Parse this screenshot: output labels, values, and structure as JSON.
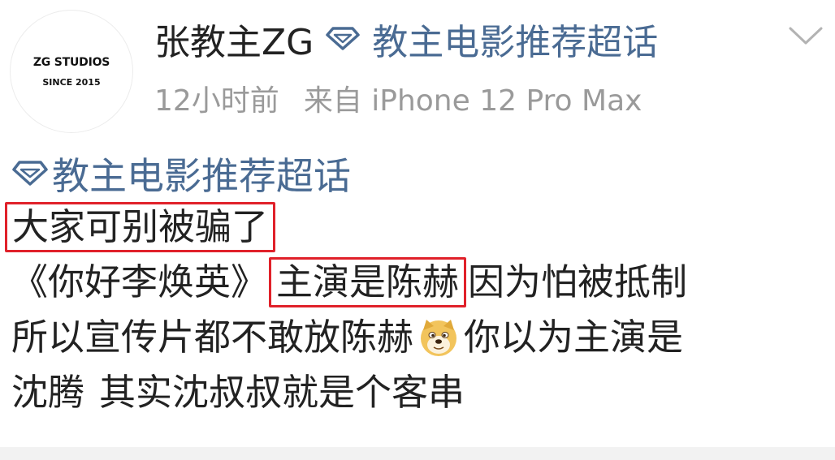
{
  "post": {
    "avatar": {
      "brand": "ZG STUDIOS",
      "since": "SINCE 2015"
    },
    "username": "张教主ZG",
    "topic_header": "教主电影推荐超话",
    "time_ago": "12小时前",
    "source": "来自 iPhone 12 Pro Max",
    "topic_tag": "教主电影推荐超话",
    "lines": {
      "l1_hl": "大家可别被骗了",
      "l2_a": "《你好李焕英》",
      "l2_hl": "主演是陈赫",
      "l2_b": "因为怕被抵制",
      "l3_a": "所以宣传片都不敢放陈赫",
      "l3_b": "你以为主演是",
      "l4_a": "沈腾",
      "l4_b": "其实沈叔叔就是个客串"
    }
  },
  "colors": {
    "link": "#4a6b93",
    "text": "#222222",
    "meta": "#9a9a9a",
    "highlight_box": "#e0212a"
  },
  "icons": {
    "super_topic": "diamond-icon",
    "expand": "chevron-down-icon",
    "emoji": "doge-emoji"
  }
}
